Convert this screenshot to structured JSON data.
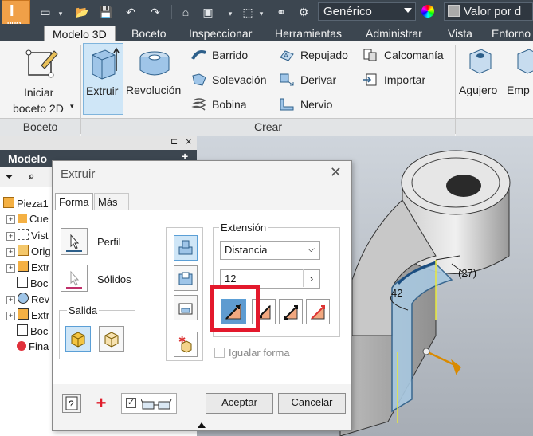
{
  "app": {
    "logo_letter": "I",
    "logo_badge": "PRO",
    "material_value": "Genérico",
    "appearance_value": "Valor por d"
  },
  "tabs": [
    "Modelo 3D",
    "Boceto",
    "Inspeccionar",
    "Herramientas",
    "Administrar",
    "Vista",
    "Entorno"
  ],
  "ribbon": {
    "boceto_panel": {
      "start_label_1": "Iniciar",
      "start_label_2": "boceto 2D",
      "panel_title": "Boceto"
    },
    "crear_panel": {
      "extruir": "Extruir",
      "revolucion": "Revolución",
      "barrido": "Barrido",
      "solevacion": "Solevación",
      "bobina": "Bobina",
      "repujado": "Repujado",
      "derivar": "Derivar",
      "nervio": "Nervio",
      "calcomania": "Calcomanía",
      "importar": "Importar",
      "panel_title": "Crear"
    },
    "modify_panel": {
      "agujero": "Agujero",
      "empalme": "Emp"
    }
  },
  "browser": {
    "title": "Modelo",
    "items": [
      {
        "label": "Pieza1",
        "expander": ""
      },
      {
        "label": "Cue",
        "expander": "+"
      },
      {
        "label": "Vist",
        "expander": "+"
      },
      {
        "label": "Orig",
        "expander": "+"
      },
      {
        "label": "Extr",
        "expander": "+"
      },
      {
        "label": "Boc",
        "expander": ""
      },
      {
        "label": "Rev",
        "expander": "+"
      },
      {
        "label": "Extr",
        "expander": "+"
      },
      {
        "label": "Boc",
        "expander": ""
      },
      {
        "label": "Fina",
        "expander": ""
      }
    ]
  },
  "viewport": {
    "dim_angle": "42",
    "dim_ref": "(27)"
  },
  "dialog": {
    "title": "Extruir",
    "tab_forma": "Forma",
    "tab_mas": "Más",
    "perfil": "Perfil",
    "solidos": "Sólidos",
    "salida": "Salida",
    "extension": "Extensión",
    "extension_value": "Distancia",
    "distance_value": "12",
    "igualar_forma": "Igualar forma",
    "aceptar": "Aceptar",
    "cancelar": "Cancelar"
  },
  "colors": {
    "title_bar": "#3c4650",
    "selection_blue": "#cfe6f7",
    "highlight_red": "#e3192c",
    "axis_orange": "#d98a00"
  }
}
